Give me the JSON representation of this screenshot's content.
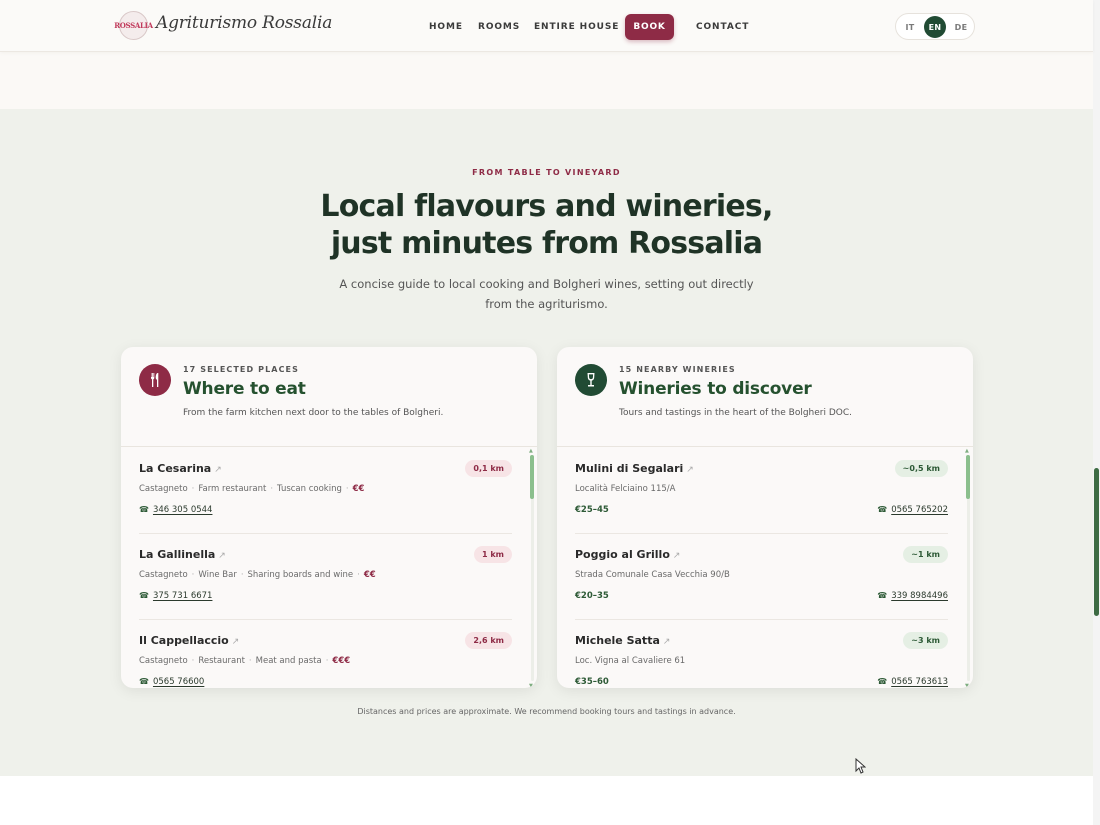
{
  "header": {
    "brand": "Agriturismo Rossalia",
    "logo_text": "ROSSALIA",
    "nav": [
      {
        "label": "HOME"
      },
      {
        "label": "ROOMS"
      },
      {
        "label": "ENTIRE HOUSE"
      },
      {
        "label": "CONTACT"
      }
    ],
    "book_label": "BOOK",
    "languages": [
      {
        "code": "IT",
        "active": false
      },
      {
        "code": "EN",
        "active": true
      },
      {
        "code": "DE",
        "active": false
      }
    ]
  },
  "intro": {
    "eyebrow": "FROM TABLE TO VINEYARD",
    "title_line1": "Local flavours and wineries,",
    "title_line2": "just minutes from Rossalia",
    "lead": "A concise guide to local cooking and Bolgheri wines, setting out directly from the agriturismo."
  },
  "eat": {
    "icon": "fork-knife-icon",
    "accent": "#8e2b46",
    "kicker": "17 SELECTED PLACES",
    "title": "Where to eat",
    "subtitle": "From the farm kitchen next door to the tables of Bolgheri.",
    "items": [
      {
        "name": "La Cesarina",
        "distance": "0,1 km",
        "town": "Castagneto",
        "type": "Farm restaurant",
        "cuisine": "Tuscan cooking",
        "price": "€€",
        "phone": "346 305 0544"
      },
      {
        "name": "La Gallinella",
        "distance": "1 km",
        "town": "Castagneto",
        "type": "Wine Bar",
        "cuisine": "Sharing boards and wine",
        "price": "€€",
        "phone": "375 731 6671"
      },
      {
        "name": "Il Cappellaccio",
        "distance": "2,6 km",
        "town": "Castagneto",
        "type": "Restaurant",
        "cuisine": "Meat and pasta",
        "price": "€€€",
        "phone": "0565 76600"
      }
    ]
  },
  "wineries": {
    "icon": "wine-glass-icon",
    "accent": "#214b34",
    "kicker": "15 NEARBY WINERIES",
    "title": "Wineries to discover",
    "subtitle": "Tours and tastings in the heart of the Bolgheri DOC.",
    "items": [
      {
        "name": "Mulini di Segalari",
        "distance": "~0,5 km",
        "address": "Località Felciaino 115/A",
        "price": "€25–45",
        "phone": "0565 765202"
      },
      {
        "name": "Poggio al Grillo",
        "distance": "~1 km",
        "address": "Strada Comunale Casa Vecchia 90/B",
        "price": "€20–35",
        "phone": "339 8984496"
      },
      {
        "name": "Michele Satta",
        "distance": "~3 km",
        "address": "Loc. Vigna al Cavaliere 61",
        "price": "€35–60",
        "phone": "0565 763613"
      }
    ]
  },
  "footnote": "Distances and prices are approximate. We recommend booking tours and tastings in advance."
}
